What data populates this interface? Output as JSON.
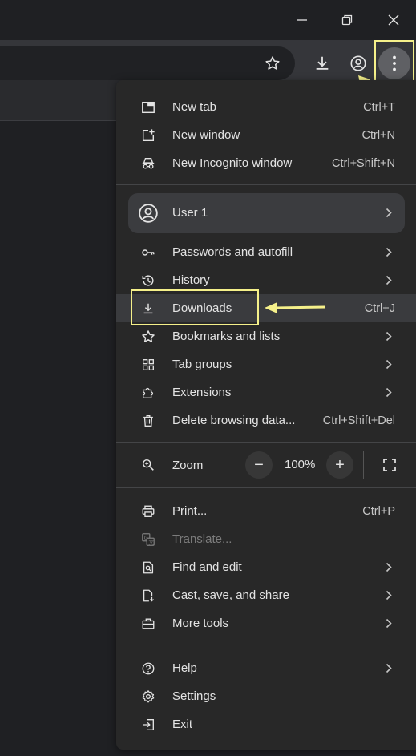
{
  "colors": {
    "accent_highlight": "#f5f08a",
    "menu_bg": "#282828",
    "text": "#e3e3e3"
  },
  "window_controls": {
    "minimize_icon": "minimize-icon",
    "restore_icon": "restore-icon",
    "close_icon": "close-icon"
  },
  "menu": {
    "sections": [
      {
        "items": [
          {
            "label": "New tab",
            "shortcut": "Ctrl+T",
            "icon": "new-tab-icon"
          },
          {
            "label": "New window",
            "shortcut": "Ctrl+N",
            "icon": "new-window-icon"
          },
          {
            "label": "New Incognito window",
            "shortcut": "Ctrl+Shift+N",
            "icon": "incognito-icon"
          }
        ]
      },
      {
        "profile": {
          "label": "User 1",
          "icon": "avatar-icon"
        },
        "items": [
          {
            "label": "Passwords and autofill",
            "icon": "key-icon",
            "submenu": true
          },
          {
            "label": "History",
            "icon": "history-icon",
            "submenu": true
          },
          {
            "label": "Downloads",
            "shortcut": "Ctrl+J",
            "icon": "download-icon"
          },
          {
            "label": "Bookmarks and lists",
            "icon": "star-icon",
            "submenu": true
          },
          {
            "label": "Tab groups",
            "icon": "tab-groups-icon",
            "submenu": true
          },
          {
            "label": "Extensions",
            "icon": "extension-icon",
            "submenu": true
          },
          {
            "label": "Delete browsing data...",
            "shortcut": "Ctrl+Shift+Del",
            "icon": "trash-icon"
          }
        ]
      },
      {
        "zoom": {
          "label": "Zoom",
          "value": "100%",
          "minus": "−",
          "plus": "+"
        }
      },
      {
        "items": [
          {
            "label": "Print...",
            "shortcut": "Ctrl+P",
            "icon": "print-icon"
          },
          {
            "label": "Translate...",
            "icon": "translate-icon",
            "disabled": true
          },
          {
            "label": "Find and edit",
            "icon": "find-icon",
            "submenu": true
          },
          {
            "label": "Cast, save, and share",
            "icon": "cast-save-icon",
            "submenu": true
          },
          {
            "label": "More tools",
            "icon": "toolbox-icon",
            "submenu": true
          }
        ]
      },
      {
        "items": [
          {
            "label": "Help",
            "icon": "help-icon",
            "submenu": true
          },
          {
            "label": "Settings",
            "icon": "gear-icon"
          },
          {
            "label": "Exit",
            "icon": "exit-icon"
          }
        ]
      }
    ]
  }
}
